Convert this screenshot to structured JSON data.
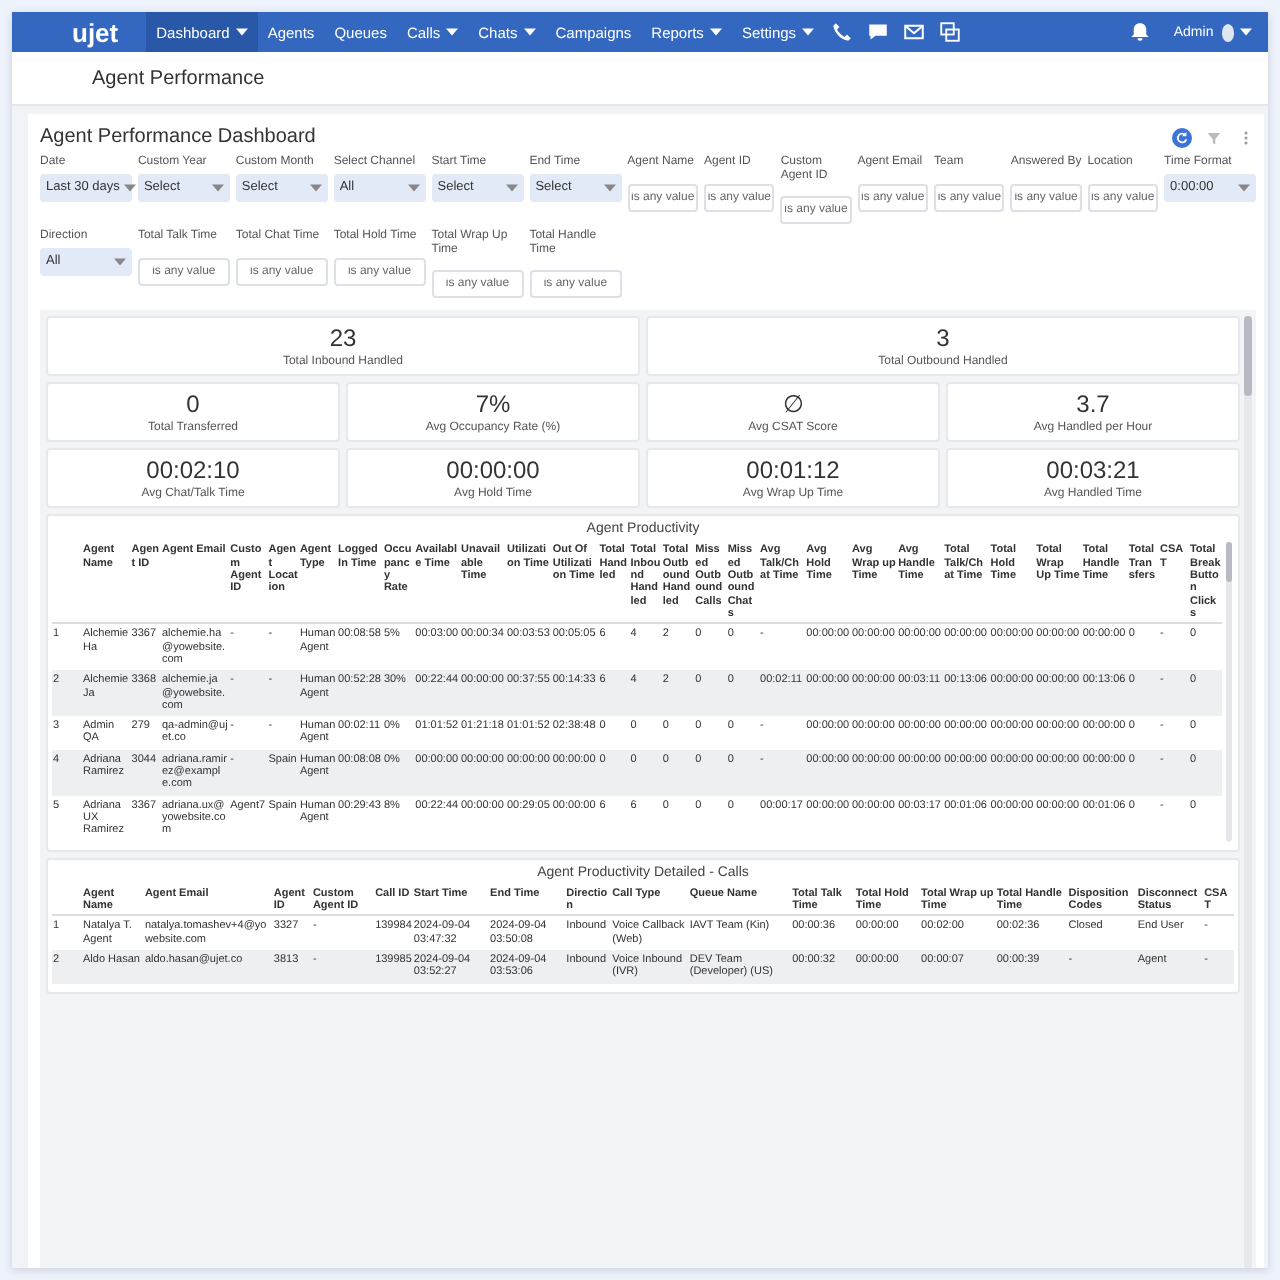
{
  "nav": {
    "logo": "ujet",
    "items": [
      {
        "label": "Dashboard",
        "has_menu": true,
        "selected": true
      },
      {
        "label": "Agents",
        "has_menu": false,
        "selected": false
      },
      {
        "label": "Queues",
        "has_menu": false,
        "selected": false
      },
      {
        "label": "Calls",
        "has_menu": true,
        "selected": false
      },
      {
        "label": "Chats",
        "has_menu": true,
        "selected": false
      },
      {
        "label": "Campaigns",
        "has_menu": false,
        "selected": false
      },
      {
        "label": "Reports",
        "has_menu": true,
        "selected": false
      },
      {
        "label": "Settings",
        "has_menu": true,
        "selected": false
      }
    ],
    "user": "Admin"
  },
  "page_title": "Agent Performance",
  "dashboard": {
    "title": "Agent Performance Dashboard",
    "filters": [
      {
        "label": "Date",
        "kind": "select",
        "value": "Last 30 days"
      },
      {
        "label": "Custom Year",
        "kind": "select",
        "value": "Select"
      },
      {
        "label": "Custom Month",
        "kind": "select",
        "value": "Select"
      },
      {
        "label": "Select Channel",
        "kind": "select",
        "value": "All"
      },
      {
        "label": "Start Time",
        "kind": "select",
        "value": "Select"
      },
      {
        "label": "End Time",
        "kind": "select",
        "value": "Select"
      },
      {
        "label": "Agent Name",
        "kind": "text",
        "placeholder": "is any value"
      },
      {
        "label": "Agent ID",
        "kind": "text",
        "placeholder": "is any value"
      },
      {
        "label": "Custom Agent ID",
        "kind": "text",
        "placeholder": "is any value"
      },
      {
        "label": "Agent Email",
        "kind": "text",
        "placeholder": "is any value"
      },
      {
        "label": "Team",
        "kind": "text",
        "placeholder": "is any value"
      },
      {
        "label": "Answered By",
        "kind": "text",
        "placeholder": "is any value"
      },
      {
        "label": "Location",
        "kind": "text",
        "placeholder": "is any value"
      },
      {
        "label": "Time Format",
        "kind": "select",
        "value": "0:00:00"
      },
      {
        "label": "Direction",
        "kind": "select",
        "value": "All"
      },
      {
        "label": "Total Talk Time",
        "kind": "text",
        "placeholder": "is any value"
      },
      {
        "label": "Total Chat Time",
        "kind": "text",
        "placeholder": "is any value"
      },
      {
        "label": "Total Hold Time",
        "kind": "text",
        "placeholder": "is any value"
      },
      {
        "label": "Total Wrap Up Time",
        "kind": "text",
        "placeholder": "is any value"
      },
      {
        "label": "Total Handle Time",
        "kind": "text",
        "placeholder": "is any value"
      }
    ],
    "stats": [
      [
        {
          "value": "23",
          "label": "Total Inbound Handled"
        },
        {
          "value": "3",
          "label": "Total Outbound Handled"
        }
      ],
      [
        {
          "value": "0",
          "label": "Total Transferred"
        },
        {
          "value": "7%",
          "label": "Avg Occupancy Rate (%)"
        },
        {
          "value": "∅",
          "label": "Avg CSAT Score"
        },
        {
          "value": "3.7",
          "label": "Avg Handled per Hour"
        }
      ],
      [
        {
          "value": "00:02:10",
          "label": "Avg Chat/Talk Time"
        },
        {
          "value": "00:00:00",
          "label": "Avg Hold Time"
        },
        {
          "value": "00:01:12",
          "label": "Avg Wrap Up Time"
        },
        {
          "value": "00:03:21",
          "label": "Avg Handled Time"
        }
      ]
    ],
    "productivity": {
      "title": "Agent Productivity",
      "columns": [
        "",
        "Agent Name",
        "Agent ID",
        "Agent Email",
        "Custom Agent ID",
        "Agent Location",
        "Agent Type",
        "Logged In Time",
        "Occupancy Rate",
        "Available Time",
        "Unavailable Time",
        "Utilization Time",
        "Out Of Utilization Time",
        "Total Handled",
        "Total Inbound Handled",
        "Total Outbound Handled",
        "Missed Outbound Calls",
        "Missed Outbound Chats",
        "Avg Talk/Chat Time",
        "Avg Hold Time",
        "Avg Wrap up Time",
        "Avg Handle Time",
        "Total Talk/Chat Time",
        "Total Hold Time",
        "Total Wrap Up Time",
        "Total Handle Time",
        "Total Transfers",
        "CSAT",
        "Total Break Button Clicks"
      ],
      "rows": [
        [
          "1",
          "Alchemie Ha",
          "3367",
          "alchemie.ha@yowebsite.com",
          "-",
          "-",
          "Human Agent",
          "00:08:58",
          "5%",
          "00:03:00",
          "00:00:34",
          "00:03:53",
          "00:05:05",
          "6",
          "4",
          "2",
          "0",
          "0",
          "-",
          "00:00:00",
          "00:00:00",
          "00:00:00",
          "00:00:00",
          "00:00:00",
          "00:00:00",
          "00:00:00",
          "0",
          "-",
          "0"
        ],
        [
          "2",
          "Alchemie Ja",
          "3368",
          "alchemie.ja@yowebsite.com",
          "-",
          "-",
          "Human Agent",
          "00:52:28",
          "30%",
          "00:22:44",
          "00:00:00",
          "00:37:55",
          "00:14:33",
          "6",
          "4",
          "2",
          "0",
          "0",
          "00:02:11",
          "00:00:00",
          "00:00:00",
          "00:03:11",
          "00:13:06",
          "00:00:00",
          "00:00:00",
          "00:13:06",
          "0",
          "-",
          "0"
        ],
        [
          "3",
          "Admin QA",
          "279",
          "qa-admin@ujet.co",
          "-",
          "-",
          "Human Agent",
          "00:02:11",
          "0%",
          "01:01:52",
          "01:21:18",
          "01:01:52",
          "02:38:48",
          "0",
          "0",
          "0",
          "0",
          "0",
          "-",
          "00:00:00",
          "00:00:00",
          "00:00:00",
          "00:00:00",
          "00:00:00",
          "00:00:00",
          "00:00:00",
          "0",
          "-",
          "0"
        ],
        [
          "4",
          "Adriana Ramirez",
          "3044",
          "adriana.ramirez@example.com",
          "-",
          "Spain",
          "Human Agent",
          "00:08:08",
          "0%",
          "00:00:00",
          "00:00:00",
          "00:00:00",
          "00:00:00",
          "0",
          "0",
          "0",
          "0",
          "0",
          "-",
          "00:00:00",
          "00:00:00",
          "00:00:00",
          "00:00:00",
          "00:00:00",
          "00:00:00",
          "00:00:00",
          "0",
          "-",
          "0"
        ],
        [
          "5",
          "Adriana UX Ramirez",
          "3367",
          "adriana.ux@yowebsite.com",
          "Agent7",
          "Spain",
          "Human Agent",
          "00:29:43",
          "8%",
          "00:22:44",
          "00:00:00",
          "00:29:05",
          "00:00:00",
          "6",
          "6",
          "0",
          "0",
          "0",
          "00:00:17",
          "00:00:00",
          "00:00:00",
          "00:03:17",
          "00:01:06",
          "00:00:00",
          "00:00:00",
          "00:01:06",
          "0",
          "-",
          "0"
        ]
      ]
    },
    "calls": {
      "title": "Agent Productivity Detailed - Calls",
      "columns": [
        "",
        "Agent Name",
        "Agent Email",
        "Agent ID",
        "Custom Agent ID",
        "Call ID",
        "Start Time",
        "End Time",
        "Direction",
        "Call Type",
        "Queue Name",
        "Total Talk Time",
        "Total Hold Time",
        "Total Wrap up Time",
        "Total Handle Time",
        "Disposition Codes",
        "Disconnect Status",
        "CSAT"
      ],
      "rows": [
        [
          "1",
          "Natalya T. Agent",
          "natalya.tomashev+4@yowebsite.com",
          "3327",
          "-",
          "139984",
          "2024-09-04 03:47:32",
          "2024-09-04 03:50:08",
          "Inbound",
          "Voice Callback (Web)",
          "IAVT Team (Kin)",
          "00:00:36",
          "00:00:00",
          "00:02:00",
          "00:02:36",
          "Closed",
          "End User",
          "-"
        ],
        [
          "2",
          "Aldo Hasan",
          "aldo.hasan@ujet.co",
          "3813",
          "-",
          "139985",
          "2024-09-04 03:52:27",
          "2024-09-04 03:53:06",
          "Inbound",
          "Voice Inbound (IVR)",
          "DEV Team (Developer) (US)",
          "00:00:32",
          "00:00:00",
          "00:00:07",
          "00:00:39",
          "-",
          "Agent",
          "-"
        ]
      ]
    }
  }
}
